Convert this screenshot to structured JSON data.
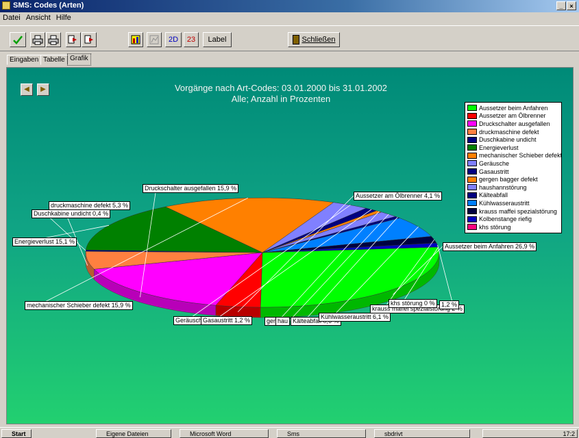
{
  "window": {
    "title": "SMS: Codes (Arten)",
    "buttons": [
      "_",
      "×"
    ]
  },
  "menu": [
    "Datei",
    "Ansicht",
    "Hilfe"
  ],
  "toolbar": {
    "twod_label": "2D",
    "three_label": "23",
    "label_button": "Label",
    "close_button": "Schließen",
    "colors": {
      "check": "#00a000",
      "print": "#000080",
      "export": "#c00000"
    }
  },
  "tabs": [
    "Eingaben",
    "Tabelle",
    "Grafik"
  ],
  "active_tab": "Grafik",
  "chart_data": {
    "type": "pie",
    "title": "Vorgänge nach Art-Codes: 03.01.2000 bis 31.01.2002",
    "subtitle": "Alle; Anzahl in Prozenten",
    "legend_placement": "right",
    "series": [
      {
        "name": "Aussetzer beim Anfahren",
        "value": 26.9,
        "color": "#00ff00",
        "label": "Aussetzer beim Anfahren 26,9 %"
      },
      {
        "name": "Aussetzer am Ölbrenner",
        "value": 4.1,
        "color": "#ff0000",
        "label": "Aussetzer am Ölbrenner 4,1 %"
      },
      {
        "name": "Druckschalter ausgefallen",
        "value": 15.9,
        "color": "#ff00ff",
        "label": "Druckschalter ausgefallen 15,9 %"
      },
      {
        "name": "druckmaschine defekt",
        "value": 5.3,
        "color": "#ff8040",
        "label": "druckmaschine defekt 5,3 %"
      },
      {
        "name": "Duschkabine undicht",
        "value": 0.4,
        "color": "#000080",
        "label": "Duschkabine undicht 0,4 %"
      },
      {
        "name": "Energieverlust",
        "value": 15.1,
        "color": "#008000",
        "label": "Energieverlust 15,1 %"
      },
      {
        "name": "mechanischer Schieber defekt",
        "value": 15.9,
        "color": "#ff8000",
        "label": "mechanischer Schieber defekt 15,9 %"
      },
      {
        "name": "Geräusche",
        "value": 3.4,
        "color": "#8080ff",
        "label": "Geräusche"
      },
      {
        "name": "Gasaustritt",
        "value": 1.2,
        "color": "#000080",
        "label": "Gasaustritt 1,2 %"
      },
      {
        "name": "gergen bagger defekt",
        "value": 0.6,
        "color": "#ff8000",
        "label": "ger"
      },
      {
        "name": "haushannstörung",
        "value": 1.8,
        "color": "#8080ff",
        "label": "hau"
      },
      {
        "name": "Kälteabfall",
        "value": 0.6,
        "color": "#000080",
        "label": "Kälteabfall 0,6 %"
      },
      {
        "name": "Kühlwasseraustritt",
        "value": 6.1,
        "color": "#0080ff",
        "label": "Kühlwasseraustritt 6,1 %"
      },
      {
        "name": "krauss maffei spezialstörung",
        "value": 2.0,
        "color": "#000040",
        "label": "krauss maffei spezialstörung 2 %"
      },
      {
        "name": "Kolbenstange riefig",
        "value": 1.2,
        "color": "#0000c0",
        "label": "1,2 %"
      },
      {
        "name": "khs störung",
        "value": 0,
        "color": "#ff0080",
        "label": "khs störung 0 %"
      }
    ]
  },
  "taskbar": {
    "start": "Start",
    "items": [
      "Eigene Dateien",
      "Microsoft Word",
      "Sms",
      "sbdrivt"
    ],
    "time": "17:2"
  }
}
